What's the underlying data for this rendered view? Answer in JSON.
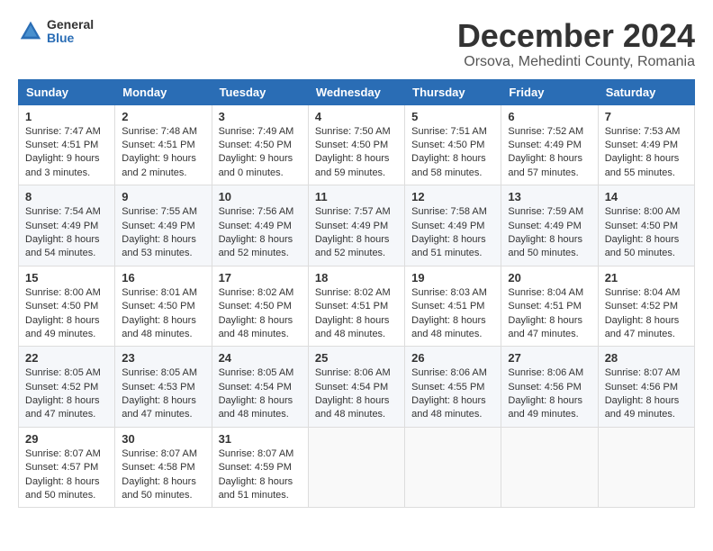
{
  "logo": {
    "general": "General",
    "blue": "Blue"
  },
  "title": "December 2024",
  "subtitle": "Orsova, Mehedinti County, Romania",
  "headers": [
    "Sunday",
    "Monday",
    "Tuesday",
    "Wednesday",
    "Thursday",
    "Friday",
    "Saturday"
  ],
  "weeks": [
    [
      {
        "day": "1",
        "info": "Sunrise: 7:47 AM\nSunset: 4:51 PM\nDaylight: 9 hours and 3 minutes."
      },
      {
        "day": "2",
        "info": "Sunrise: 7:48 AM\nSunset: 4:51 PM\nDaylight: 9 hours and 2 minutes."
      },
      {
        "day": "3",
        "info": "Sunrise: 7:49 AM\nSunset: 4:50 PM\nDaylight: 9 hours and 0 minutes."
      },
      {
        "day": "4",
        "info": "Sunrise: 7:50 AM\nSunset: 4:50 PM\nDaylight: 8 hours and 59 minutes."
      },
      {
        "day": "5",
        "info": "Sunrise: 7:51 AM\nSunset: 4:50 PM\nDaylight: 8 hours and 58 minutes."
      },
      {
        "day": "6",
        "info": "Sunrise: 7:52 AM\nSunset: 4:49 PM\nDaylight: 8 hours and 57 minutes."
      },
      {
        "day": "7",
        "info": "Sunrise: 7:53 AM\nSunset: 4:49 PM\nDaylight: 8 hours and 55 minutes."
      }
    ],
    [
      {
        "day": "8",
        "info": "Sunrise: 7:54 AM\nSunset: 4:49 PM\nDaylight: 8 hours and 54 minutes."
      },
      {
        "day": "9",
        "info": "Sunrise: 7:55 AM\nSunset: 4:49 PM\nDaylight: 8 hours and 53 minutes."
      },
      {
        "day": "10",
        "info": "Sunrise: 7:56 AM\nSunset: 4:49 PM\nDaylight: 8 hours and 52 minutes."
      },
      {
        "day": "11",
        "info": "Sunrise: 7:57 AM\nSunset: 4:49 PM\nDaylight: 8 hours and 52 minutes."
      },
      {
        "day": "12",
        "info": "Sunrise: 7:58 AM\nSunset: 4:49 PM\nDaylight: 8 hours and 51 minutes."
      },
      {
        "day": "13",
        "info": "Sunrise: 7:59 AM\nSunset: 4:49 PM\nDaylight: 8 hours and 50 minutes."
      },
      {
        "day": "14",
        "info": "Sunrise: 8:00 AM\nSunset: 4:50 PM\nDaylight: 8 hours and 50 minutes."
      }
    ],
    [
      {
        "day": "15",
        "info": "Sunrise: 8:00 AM\nSunset: 4:50 PM\nDaylight: 8 hours and 49 minutes."
      },
      {
        "day": "16",
        "info": "Sunrise: 8:01 AM\nSunset: 4:50 PM\nDaylight: 8 hours and 48 minutes."
      },
      {
        "day": "17",
        "info": "Sunrise: 8:02 AM\nSunset: 4:50 PM\nDaylight: 8 hours and 48 minutes."
      },
      {
        "day": "18",
        "info": "Sunrise: 8:02 AM\nSunset: 4:51 PM\nDaylight: 8 hours and 48 minutes."
      },
      {
        "day": "19",
        "info": "Sunrise: 8:03 AM\nSunset: 4:51 PM\nDaylight: 8 hours and 48 minutes."
      },
      {
        "day": "20",
        "info": "Sunrise: 8:04 AM\nSunset: 4:51 PM\nDaylight: 8 hours and 47 minutes."
      },
      {
        "day": "21",
        "info": "Sunrise: 8:04 AM\nSunset: 4:52 PM\nDaylight: 8 hours and 47 minutes."
      }
    ],
    [
      {
        "day": "22",
        "info": "Sunrise: 8:05 AM\nSunset: 4:52 PM\nDaylight: 8 hours and 47 minutes."
      },
      {
        "day": "23",
        "info": "Sunrise: 8:05 AM\nSunset: 4:53 PM\nDaylight: 8 hours and 47 minutes."
      },
      {
        "day": "24",
        "info": "Sunrise: 8:05 AM\nSunset: 4:54 PM\nDaylight: 8 hours and 48 minutes."
      },
      {
        "day": "25",
        "info": "Sunrise: 8:06 AM\nSunset: 4:54 PM\nDaylight: 8 hours and 48 minutes."
      },
      {
        "day": "26",
        "info": "Sunrise: 8:06 AM\nSunset: 4:55 PM\nDaylight: 8 hours and 48 minutes."
      },
      {
        "day": "27",
        "info": "Sunrise: 8:06 AM\nSunset: 4:56 PM\nDaylight: 8 hours and 49 minutes."
      },
      {
        "day": "28",
        "info": "Sunrise: 8:07 AM\nSunset: 4:56 PM\nDaylight: 8 hours and 49 minutes."
      }
    ],
    [
      {
        "day": "29",
        "info": "Sunrise: 8:07 AM\nSunset: 4:57 PM\nDaylight: 8 hours and 50 minutes."
      },
      {
        "day": "30",
        "info": "Sunrise: 8:07 AM\nSunset: 4:58 PM\nDaylight: 8 hours and 50 minutes."
      },
      {
        "day": "31",
        "info": "Sunrise: 8:07 AM\nSunset: 4:59 PM\nDaylight: 8 hours and 51 minutes."
      },
      null,
      null,
      null,
      null
    ]
  ]
}
